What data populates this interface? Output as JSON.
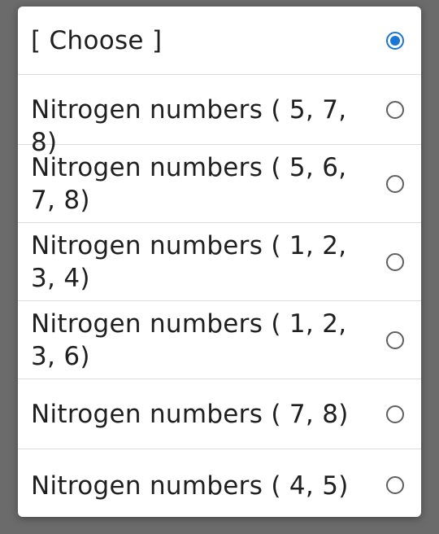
{
  "dialog": {
    "options": [
      {
        "label": "[ Choose ]",
        "selected": true
      },
      {
        "label": "Nitrogen numbers ( 5, 7, 8)",
        "selected": false
      },
      {
        "label": "Nitrogen numbers ( 5, 6, 7, 8)",
        "selected": false
      },
      {
        "label": "Nitrogen numbers ( 1, 2, 3, 4)",
        "selected": false
      },
      {
        "label": "Nitrogen numbers ( 1, 2, 3, 6)",
        "selected": false
      },
      {
        "label": "Nitrogen numbers ( 7, 8)",
        "selected": false
      },
      {
        "label": "Nitrogen numbers ( 4, 5)",
        "selected": false
      }
    ]
  },
  "colors": {
    "accent": "#1976d2",
    "overlay": "#6b6b6b"
  }
}
